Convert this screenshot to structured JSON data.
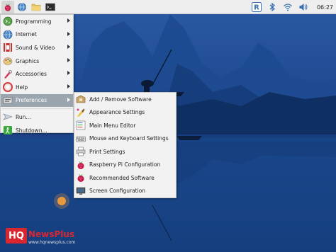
{
  "taskbar": {
    "launchers": [
      {
        "icon": "raspberry-icon"
      },
      {
        "icon": "web-browser-icon"
      },
      {
        "icon": "file-manager-icon"
      },
      {
        "icon": "terminal-icon"
      }
    ],
    "tray": {
      "icons": [
        "vnc-icon",
        "bluetooth-icon",
        "wifi-icon",
        "volume-icon"
      ],
      "clock": "06:27"
    }
  },
  "main_menu": {
    "items": [
      {
        "label": "Programming",
        "icon": "programming-icon",
        "submenu": true
      },
      {
        "label": "Internet",
        "icon": "internet-icon",
        "submenu": true
      },
      {
        "label": "Sound & Video",
        "icon": "sound-video-icon",
        "submenu": true
      },
      {
        "label": "Graphics",
        "icon": "graphics-icon",
        "submenu": true
      },
      {
        "label": "Accessories",
        "icon": "accessories-icon",
        "submenu": true
      },
      {
        "label": "Help",
        "icon": "help-icon",
        "submenu": true
      },
      {
        "label": "Preferences",
        "icon": "preferences-icon",
        "submenu": true,
        "highlighted": true
      },
      {
        "label": "Run...",
        "icon": "run-icon",
        "submenu": false
      },
      {
        "label": "Shutdown...",
        "icon": "shutdown-icon",
        "submenu": false
      }
    ]
  },
  "preferences_menu": {
    "items": [
      {
        "label": "Add / Remove Software",
        "icon": "add-remove-software-icon"
      },
      {
        "label": "Appearance Settings",
        "icon": "appearance-settings-icon"
      },
      {
        "label": "Main Menu Editor",
        "icon": "main-menu-editor-icon"
      },
      {
        "label": "Mouse and Keyboard Settings",
        "icon": "mouse-keyboard-icon"
      },
      {
        "label": "Print Settings",
        "icon": "print-settings-icon"
      },
      {
        "label": "Raspberry Pi Configuration",
        "icon": "raspberry-config-icon"
      },
      {
        "label": "Recommended Software",
        "icon": "recommended-software-icon"
      },
      {
        "label": "Screen Configuration",
        "icon": "screen-configuration-icon"
      }
    ]
  },
  "watermark": {
    "logo": "HQ",
    "name": "NewsPlus",
    "url": "www.hqnewsplus.com"
  },
  "colors": {
    "menu_bg": "#f2f2f2",
    "menu_highlight": "#9aa5ae",
    "taskbar_bg": "#eeeeee",
    "raspberry_red": "#c51a4a",
    "wallpaper_blue": "#1f4a92"
  }
}
